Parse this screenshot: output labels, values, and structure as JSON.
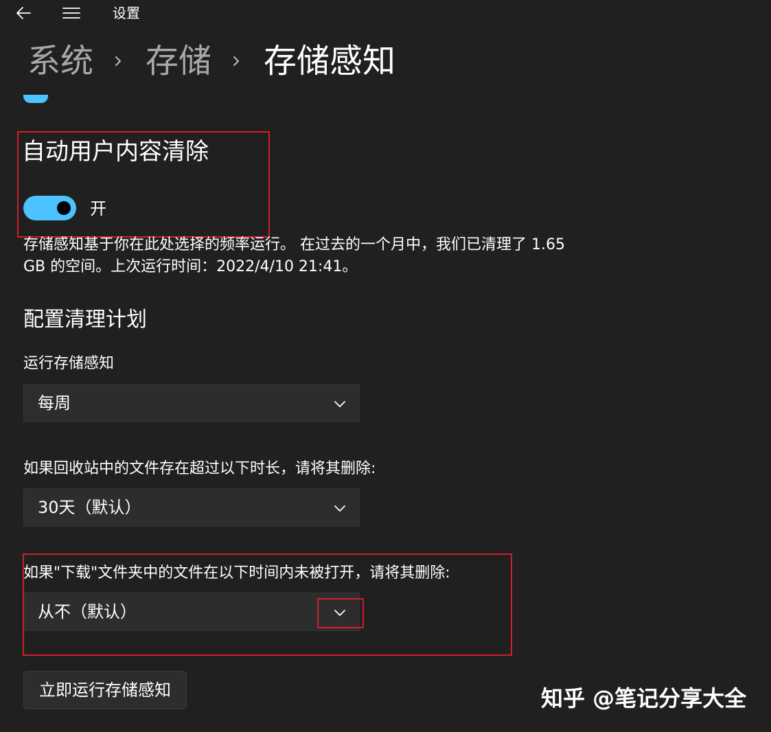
{
  "window": {
    "title": "设置"
  },
  "breadcrumb": {
    "items": [
      "系统",
      "存储",
      "存储感知"
    ]
  },
  "auto_cleanup": {
    "title": "自动用户内容清除",
    "toggle_label": "开",
    "toggle_state": "on",
    "description": "存储感知基于你在此处选择的频率运行。 在过去的一个月中，我们已清理了 1.65 GB 的空间。上次运行时间：2022/4/10 21:41。"
  },
  "schedule": {
    "title": "配置清理计划",
    "run_label": "运行存储感知",
    "run_value": "每周",
    "recycle_label": "如果回收站中的文件存在超过以下时长，请将其删除:",
    "recycle_value": "30天（默认）",
    "downloads_label": "如果\"下载\"文件夹中的文件在以下时间内未被打开，请将其删除:",
    "downloads_value": "从不（默认）"
  },
  "actions": {
    "run_now_label": "立即运行存储感知"
  },
  "watermark": {
    "text": "知乎 @笔记分享大全"
  },
  "colors": {
    "background": "#202020",
    "accent": "#4cc2ff",
    "highlight": "#d21f2a"
  }
}
